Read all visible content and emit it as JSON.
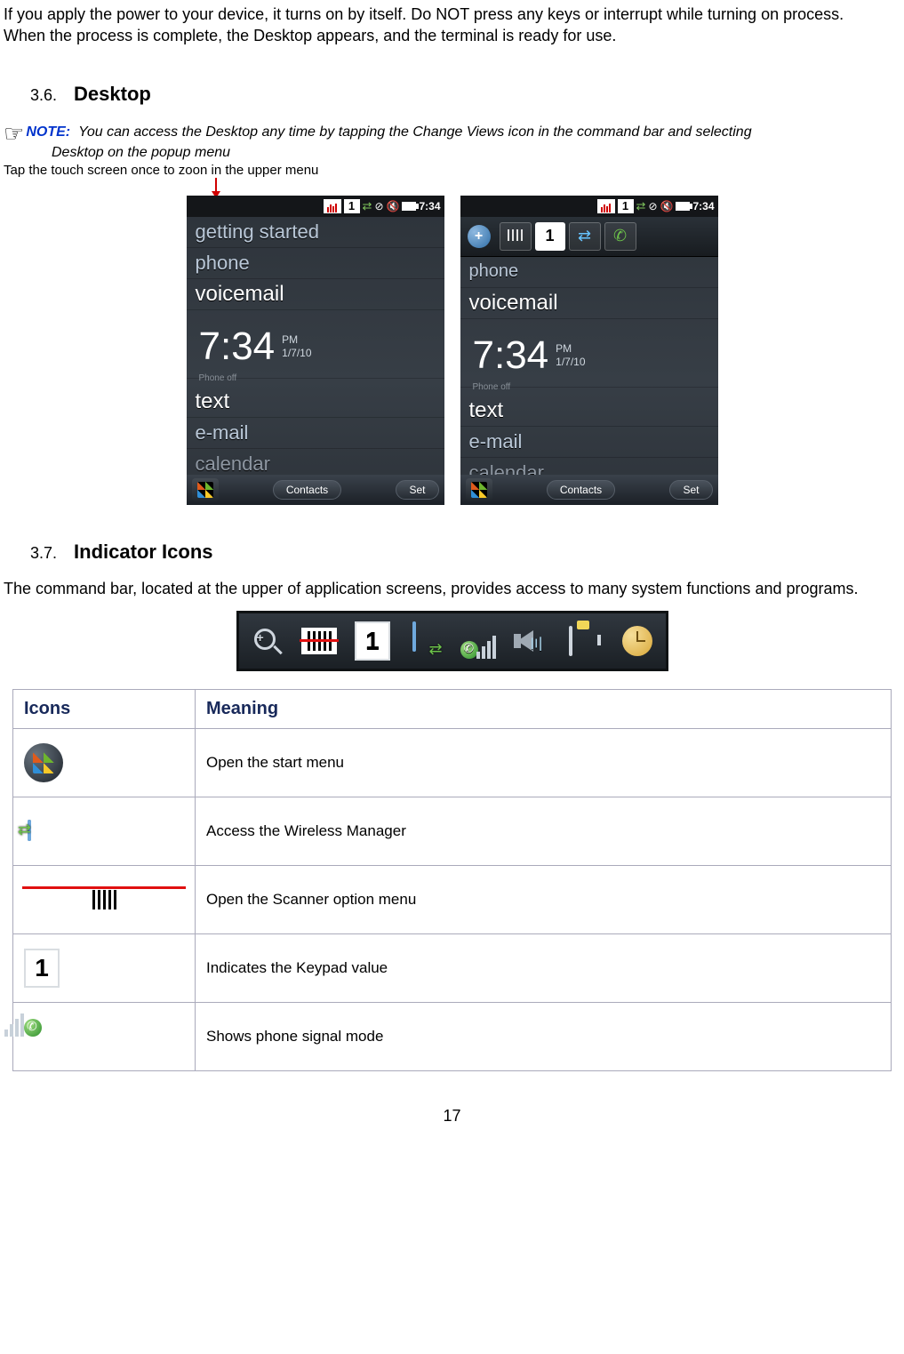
{
  "intro": {
    "p1": "If you apply the power to your device, it turns on by itself. Do NOT press any keys or interrupt while turning on process.",
    "p2": "When the process is complete, the Desktop appears, and the terminal is ready for use."
  },
  "section36": {
    "num": "3.6.",
    "title": "Desktop"
  },
  "note": {
    "label": "NOTE:",
    "line1": "You can access the Desktop any time by tapping the Change Views icon in the command bar and selecting",
    "line2": "Desktop on the popup menu"
  },
  "tap_instruction": "Tap the touch screen once to zoon in the upper menu",
  "status": {
    "time": "7:34",
    "one": "1"
  },
  "phone": {
    "menu": {
      "getting_started": "getting started",
      "phone": "phone",
      "voicemail": "voicemail",
      "text": "text",
      "email": "e-mail",
      "calendar": "calendar"
    },
    "clock": "7:34",
    "ampm": "PM",
    "date": "1/7/10",
    "phone_off": "Phone off",
    "soft": {
      "contacts": "Contacts",
      "set": "Set"
    },
    "zoom_one": "1"
  },
  "section37": {
    "num": "3.7.",
    "title": "Indicator Icons"
  },
  "indicator_intro": "The command bar, located at the upper of application screens, provides access to many system functions and programs.",
  "indicator_bar": {
    "one": "1"
  },
  "table": {
    "h_icons": "Icons",
    "h_meaning": "Meaning",
    "rows": [
      {
        "meaning": "Open the start menu"
      },
      {
        "meaning": "Access the Wireless Manager"
      },
      {
        "meaning": "Open the Scanner option menu"
      },
      {
        "meaning": "Indicates the Keypad value"
      },
      {
        "meaning": "Shows phone signal mode"
      }
    ],
    "keypad_one": "1"
  },
  "page_number": "17"
}
